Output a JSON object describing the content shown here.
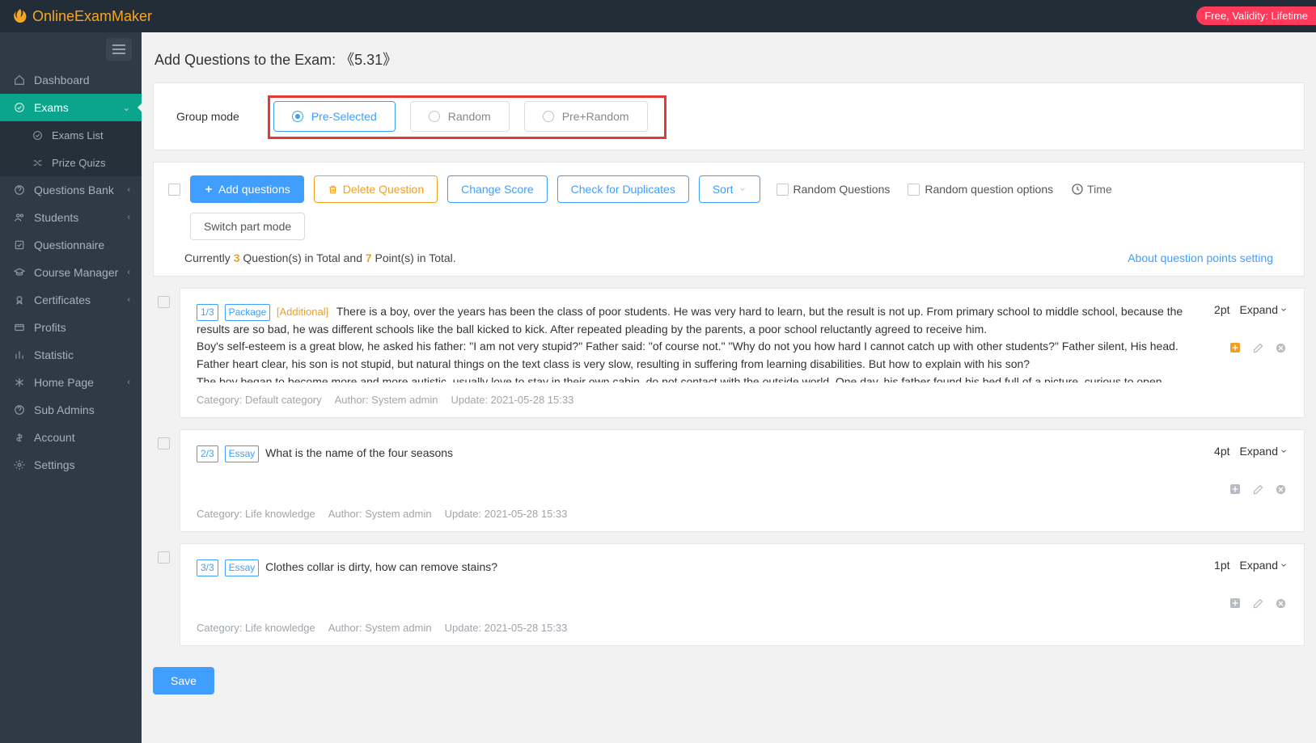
{
  "brand": "OnlineExamMaker",
  "badge": "Free, Validity: Lifetime",
  "sidebar": {
    "items": [
      {
        "label": "Dashboard"
      },
      {
        "label": "Exams"
      },
      {
        "label": "Exams List"
      },
      {
        "label": "Prize Quizs"
      },
      {
        "label": "Questions Bank"
      },
      {
        "label": "Students"
      },
      {
        "label": "Questionnaire"
      },
      {
        "label": "Course Manager"
      },
      {
        "label": "Certificates"
      },
      {
        "label": "Profits"
      },
      {
        "label": "Statistic"
      },
      {
        "label": "Home Page"
      },
      {
        "label": "Sub Admins"
      },
      {
        "label": "Account"
      },
      {
        "label": "Settings"
      }
    ]
  },
  "page": {
    "title_prefix": "Add Questions to the Exam: ",
    "exam_name": "《5.31》"
  },
  "group_mode": {
    "label": "Group mode",
    "opts": [
      "Pre-Selected",
      "Random",
      "Pre+Random"
    ]
  },
  "toolbar": {
    "add": "Add questions",
    "delete": "Delete Question",
    "change_score": "Change Score",
    "duplicates": "Check for Duplicates",
    "sort": "Sort",
    "random_q": "Random Questions",
    "random_opt": "Random question options",
    "time": "Time",
    "switch_part": "Switch part mode"
  },
  "totals": {
    "prefix": "Currently ",
    "count": "3",
    "mid": " Question(s) in Total and ",
    "points": "7",
    "suffix": " Point(s) in Total.",
    "about": "About question points setting"
  },
  "questions": [
    {
      "idx": "1/3",
      "type": "Package",
      "additional": "[Additional]",
      "text": "There is a boy, over the years has been the class of poor students. He was very hard to learn, but the result is not up. From primary school to middle school, because the results are so bad, he was different schools like the ball kicked to kick. After repeated pleading by the parents, a poor school reluctantly agreed to receive him.\nBoy's self-esteem is a great blow, he asked his father: \"I am not very stupid?\" Father said: \"of course not.\" \"Why do not you how hard I cannot catch up with other students?\" Father silent, His head.\nFather heart clear, his son is not stupid, but natural things on the text class is very slow, resulting in suffering from learning disabilities. But how to explain with his son?\nThe boy began to become more and more autistic, usually love to stay in their own cabin, do not contact with the outside world. One day, his father found his bed full of a picture, curious to open",
      "pts": "2pt",
      "cat": "Category: Default category",
      "auth": "Author: System admin",
      "upd": "Update: 2021-05-28 15:33",
      "add_icon": true
    },
    {
      "idx": "2/3",
      "type": "Essay",
      "additional": "",
      "text": "What is the name of the four seasons",
      "pts": "4pt",
      "cat": "Category: Life knowledge",
      "auth": "Author: System admin",
      "upd": "Update: 2021-05-28 15:33",
      "add_icon": false
    },
    {
      "idx": "3/3",
      "type": "Essay",
      "additional": "",
      "text": "Clothes collar is dirty, how can remove stains?",
      "pts": "1pt",
      "cat": "Category: Life knowledge",
      "auth": "Author: System admin",
      "upd": "Update: 2021-05-28 15:33",
      "add_icon": false
    }
  ],
  "expand": "Expand",
  "save": "Save"
}
